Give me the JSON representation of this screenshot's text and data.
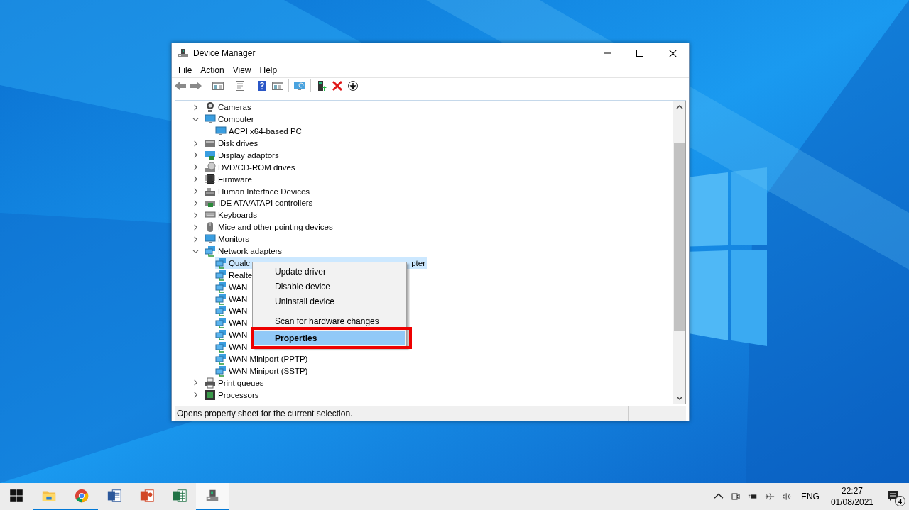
{
  "window": {
    "title": "Device Manager"
  },
  "menu_bar": [
    "File",
    "Action",
    "View",
    "Help"
  ],
  "toolbar": [
    {
      "kind": "back",
      "disabled": false
    },
    {
      "kind": "forward",
      "disabled": false
    },
    {
      "kind": "separator"
    },
    {
      "kind": "pane"
    },
    {
      "kind": "separator"
    },
    {
      "kind": "sheet"
    },
    {
      "kind": "separator"
    },
    {
      "kind": "help"
    },
    {
      "kind": "pane"
    },
    {
      "kind": "separator"
    },
    {
      "kind": "monitor"
    },
    {
      "kind": "separator"
    },
    {
      "kind": "update"
    },
    {
      "kind": "remove"
    },
    {
      "kind": "download"
    }
  ],
  "tree": [
    {
      "label": "Cameras",
      "kind": "camera",
      "expanded": false,
      "selected": false
    },
    {
      "label": "Computer",
      "kind": "monitor",
      "expanded": true,
      "selected": false,
      "children": [
        {
          "label": "ACPI x64-based PC",
          "kind": "monitor",
          "selected": false
        }
      ]
    },
    {
      "label": "Disk drives",
      "kind": "disk",
      "expanded": false,
      "selected": false
    },
    {
      "label": "Display adaptors",
      "kind": "display",
      "expanded": false,
      "selected": false
    },
    {
      "label": "DVD/CD-ROM drives",
      "kind": "dvd",
      "expanded": false,
      "selected": false
    },
    {
      "label": "Firmware",
      "kind": "chip",
      "expanded": false,
      "selected": false
    },
    {
      "label": "Human Interface Devices",
      "kind": "hid",
      "expanded": false,
      "selected": false
    },
    {
      "label": "IDE ATA/ATAPI controllers",
      "kind": "ide",
      "expanded": false,
      "selected": false
    },
    {
      "label": "Keyboards",
      "kind": "keyboard",
      "expanded": false,
      "selected": false
    },
    {
      "label": "Mice and other pointing devices",
      "kind": "mouse",
      "expanded": false,
      "selected": false
    },
    {
      "label": "Monitors",
      "kind": "monitor",
      "expanded": false,
      "selected": false
    },
    {
      "label": "Network adapters",
      "kind": "network",
      "expanded": true,
      "selected": false,
      "children": [
        {
          "label": "Qualc",
          "tail": "pter",
          "kind": "network",
          "selected": true
        },
        {
          "label": "Realte",
          "kind": "network",
          "selected": false
        },
        {
          "label": "WAN",
          "kind": "network",
          "selected": false
        },
        {
          "label": "WAN",
          "kind": "network",
          "selected": false
        },
        {
          "label": "WAN",
          "kind": "network",
          "selected": false
        },
        {
          "label": "WAN",
          "kind": "network",
          "selected": false
        },
        {
          "label": "WAN",
          "kind": "network",
          "selected": false
        },
        {
          "label": "WAN",
          "kind": "network",
          "selected": false
        },
        {
          "label": "WAN Miniport (PPTP)",
          "kind": "network",
          "selected": false
        },
        {
          "label": "WAN Miniport (SSTP)",
          "kind": "network",
          "selected": false
        }
      ]
    },
    {
      "label": "Print queues",
      "kind": "printer",
      "expanded": false,
      "selected": false
    },
    {
      "label": "Processors",
      "kind": "cpu",
      "expanded": false,
      "selected": false
    }
  ],
  "context_menu": [
    {
      "kind": "item",
      "label": "Update driver",
      "selected": false,
      "outlined": false
    },
    {
      "kind": "item",
      "label": "Disable device",
      "selected": false,
      "outlined": false
    },
    {
      "kind": "item",
      "label": "Uninstall device",
      "selected": false,
      "outlined": false
    },
    {
      "kind": "separator"
    },
    {
      "kind": "item",
      "label": "Scan for hardware changes",
      "selected": false,
      "outlined": false
    },
    {
      "kind": "item",
      "label": "Properties",
      "selected": true,
      "outlined": true
    }
  ],
  "status_bar": "Opens property sheet for the current selection.",
  "taskbar": {
    "apps": [
      {
        "kind": "explorer",
        "running": true,
        "active": false
      },
      {
        "kind": "chrome",
        "running": true,
        "active": false
      },
      {
        "kind": "word",
        "running": false,
        "active": false
      },
      {
        "kind": "powerpoint",
        "running": false,
        "active": false
      },
      {
        "kind": "excel",
        "running": false,
        "active": false
      },
      {
        "kind": "devmgr",
        "running": true,
        "active": true
      }
    ],
    "language": "ENG",
    "time": "22:27",
    "date": "01/08/2021",
    "notifications": "4"
  }
}
